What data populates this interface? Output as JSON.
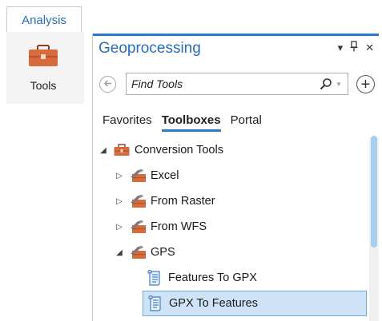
{
  "ribbon": {
    "tab_label": "Analysis",
    "tools_label": "Tools"
  },
  "pane": {
    "title": "Geoprocessing",
    "controls": {
      "menu": "▾",
      "pin": "⊥",
      "close": "✕"
    },
    "search": {
      "placeholder": "Find Tools",
      "value": ""
    },
    "tabs": [
      {
        "label": "Favorites",
        "active": false
      },
      {
        "label": "Toolboxes",
        "active": true
      },
      {
        "label": "Portal",
        "active": false
      }
    ],
    "tree": [
      {
        "label": "Conversion Tools",
        "icon": "toolbox-icon",
        "expander": "expanded"
      },
      {
        "label": "Excel",
        "icon": "toolset-icon",
        "expander": "collapsed"
      },
      {
        "label": "From Raster",
        "icon": "toolset-icon",
        "expander": "collapsed"
      },
      {
        "label": "From WFS",
        "icon": "toolset-icon",
        "expander": "collapsed"
      },
      {
        "label": "GPS",
        "icon": "toolset-icon",
        "expander": "expanded"
      },
      {
        "label": "Features To GPX",
        "icon": "script-tool-icon",
        "expander": "none"
      },
      {
        "label": "GPX To Features",
        "icon": "script-tool-icon",
        "expander": "none",
        "selected": true
      }
    ]
  },
  "colors": {
    "accent": "#2b79d0",
    "title_blue": "#2a6ebb",
    "selection": "#cfe3f6",
    "toolbox": "#d86b3d"
  }
}
